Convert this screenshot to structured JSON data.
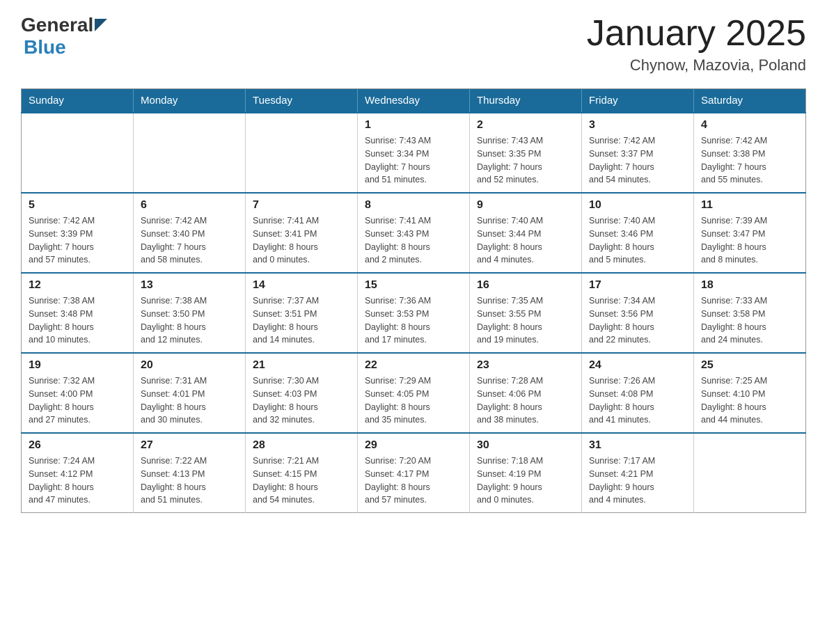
{
  "header": {
    "logo_general": "General",
    "logo_blue": "Blue",
    "title": "January 2025",
    "subtitle": "Chynow, Mazovia, Poland"
  },
  "days_of_week": [
    "Sunday",
    "Monday",
    "Tuesday",
    "Wednesday",
    "Thursday",
    "Friday",
    "Saturday"
  ],
  "weeks": [
    [
      {
        "day": "",
        "info": ""
      },
      {
        "day": "",
        "info": ""
      },
      {
        "day": "",
        "info": ""
      },
      {
        "day": "1",
        "info": "Sunrise: 7:43 AM\nSunset: 3:34 PM\nDaylight: 7 hours\nand 51 minutes."
      },
      {
        "day": "2",
        "info": "Sunrise: 7:43 AM\nSunset: 3:35 PM\nDaylight: 7 hours\nand 52 minutes."
      },
      {
        "day": "3",
        "info": "Sunrise: 7:42 AM\nSunset: 3:37 PM\nDaylight: 7 hours\nand 54 minutes."
      },
      {
        "day": "4",
        "info": "Sunrise: 7:42 AM\nSunset: 3:38 PM\nDaylight: 7 hours\nand 55 minutes."
      }
    ],
    [
      {
        "day": "5",
        "info": "Sunrise: 7:42 AM\nSunset: 3:39 PM\nDaylight: 7 hours\nand 57 minutes."
      },
      {
        "day": "6",
        "info": "Sunrise: 7:42 AM\nSunset: 3:40 PM\nDaylight: 7 hours\nand 58 minutes."
      },
      {
        "day": "7",
        "info": "Sunrise: 7:41 AM\nSunset: 3:41 PM\nDaylight: 8 hours\nand 0 minutes."
      },
      {
        "day": "8",
        "info": "Sunrise: 7:41 AM\nSunset: 3:43 PM\nDaylight: 8 hours\nand 2 minutes."
      },
      {
        "day": "9",
        "info": "Sunrise: 7:40 AM\nSunset: 3:44 PM\nDaylight: 8 hours\nand 4 minutes."
      },
      {
        "day": "10",
        "info": "Sunrise: 7:40 AM\nSunset: 3:46 PM\nDaylight: 8 hours\nand 5 minutes."
      },
      {
        "day": "11",
        "info": "Sunrise: 7:39 AM\nSunset: 3:47 PM\nDaylight: 8 hours\nand 8 minutes."
      }
    ],
    [
      {
        "day": "12",
        "info": "Sunrise: 7:38 AM\nSunset: 3:48 PM\nDaylight: 8 hours\nand 10 minutes."
      },
      {
        "day": "13",
        "info": "Sunrise: 7:38 AM\nSunset: 3:50 PM\nDaylight: 8 hours\nand 12 minutes."
      },
      {
        "day": "14",
        "info": "Sunrise: 7:37 AM\nSunset: 3:51 PM\nDaylight: 8 hours\nand 14 minutes."
      },
      {
        "day": "15",
        "info": "Sunrise: 7:36 AM\nSunset: 3:53 PM\nDaylight: 8 hours\nand 17 minutes."
      },
      {
        "day": "16",
        "info": "Sunrise: 7:35 AM\nSunset: 3:55 PM\nDaylight: 8 hours\nand 19 minutes."
      },
      {
        "day": "17",
        "info": "Sunrise: 7:34 AM\nSunset: 3:56 PM\nDaylight: 8 hours\nand 22 minutes."
      },
      {
        "day": "18",
        "info": "Sunrise: 7:33 AM\nSunset: 3:58 PM\nDaylight: 8 hours\nand 24 minutes."
      }
    ],
    [
      {
        "day": "19",
        "info": "Sunrise: 7:32 AM\nSunset: 4:00 PM\nDaylight: 8 hours\nand 27 minutes."
      },
      {
        "day": "20",
        "info": "Sunrise: 7:31 AM\nSunset: 4:01 PM\nDaylight: 8 hours\nand 30 minutes."
      },
      {
        "day": "21",
        "info": "Sunrise: 7:30 AM\nSunset: 4:03 PM\nDaylight: 8 hours\nand 32 minutes."
      },
      {
        "day": "22",
        "info": "Sunrise: 7:29 AM\nSunset: 4:05 PM\nDaylight: 8 hours\nand 35 minutes."
      },
      {
        "day": "23",
        "info": "Sunrise: 7:28 AM\nSunset: 4:06 PM\nDaylight: 8 hours\nand 38 minutes."
      },
      {
        "day": "24",
        "info": "Sunrise: 7:26 AM\nSunset: 4:08 PM\nDaylight: 8 hours\nand 41 minutes."
      },
      {
        "day": "25",
        "info": "Sunrise: 7:25 AM\nSunset: 4:10 PM\nDaylight: 8 hours\nand 44 minutes."
      }
    ],
    [
      {
        "day": "26",
        "info": "Sunrise: 7:24 AM\nSunset: 4:12 PM\nDaylight: 8 hours\nand 47 minutes."
      },
      {
        "day": "27",
        "info": "Sunrise: 7:22 AM\nSunset: 4:13 PM\nDaylight: 8 hours\nand 51 minutes."
      },
      {
        "day": "28",
        "info": "Sunrise: 7:21 AM\nSunset: 4:15 PM\nDaylight: 8 hours\nand 54 minutes."
      },
      {
        "day": "29",
        "info": "Sunrise: 7:20 AM\nSunset: 4:17 PM\nDaylight: 8 hours\nand 57 minutes."
      },
      {
        "day": "30",
        "info": "Sunrise: 7:18 AM\nSunset: 4:19 PM\nDaylight: 9 hours\nand 0 minutes."
      },
      {
        "day": "31",
        "info": "Sunrise: 7:17 AM\nSunset: 4:21 PM\nDaylight: 9 hours\nand 4 minutes."
      },
      {
        "day": "",
        "info": ""
      }
    ]
  ]
}
